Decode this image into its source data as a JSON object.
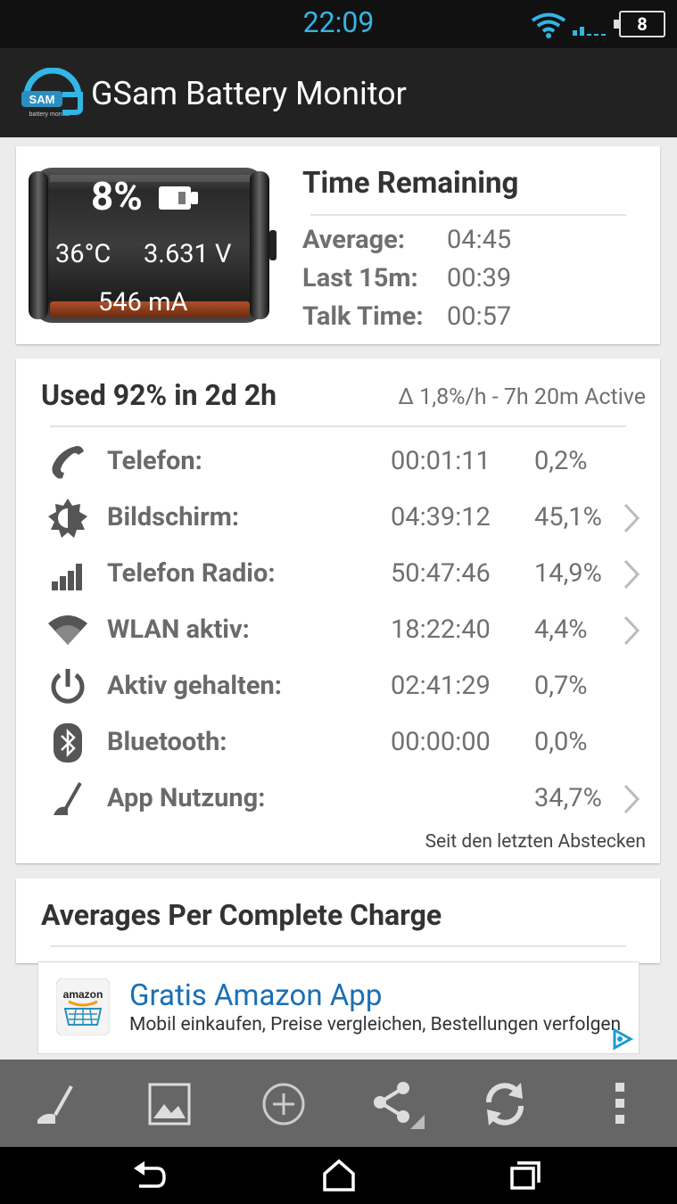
{
  "status_bar": {
    "time": "22:09",
    "battery_level": "8",
    "icons": [
      "wifi-icon",
      "signal-icon",
      "battery-icon"
    ]
  },
  "app": {
    "title": "GSam Battery Monitor",
    "logo_text": "SAM",
    "logo_subtext": "battery monitor"
  },
  "battery": {
    "percent": "8%",
    "temperature": "36°C",
    "voltage": "3.631 V",
    "current": "546 mA"
  },
  "time_remaining": {
    "title": "Time Remaining",
    "rows": [
      {
        "label": "Average:",
        "value": "04:45"
      },
      {
        "label": "Last 15m:",
        "value": "00:39"
      },
      {
        "label": "Talk Time:",
        "value": "00:57"
      }
    ]
  },
  "usage": {
    "title": "Used 92% in 2d 2h",
    "rate": "Δ 1,8%/h - 7h 20m Active",
    "rows": [
      {
        "icon": "phone-icon",
        "label": "Telefon:",
        "time": "00:01:11",
        "percent": "0,2%",
        "has_detail": false
      },
      {
        "icon": "brightness-icon",
        "label": "Bildschirm:",
        "time": "04:39:12",
        "percent": "45,1%",
        "has_detail": true
      },
      {
        "icon": "signal-bars-icon",
        "label": "Telefon Radio:",
        "time": "50:47:46",
        "percent": "14,9%",
        "has_detail": true
      },
      {
        "icon": "wifi-icon",
        "label": "WLAN aktiv:",
        "time": "18:22:40",
        "percent": "4,4%",
        "has_detail": true
      },
      {
        "icon": "power-icon",
        "label": "Aktiv gehalten:",
        "time": "02:41:29",
        "percent": "0,7%",
        "has_detail": false
      },
      {
        "icon": "bluetooth-icon",
        "label": "Bluetooth:",
        "time": "00:00:00",
        "percent": "0,0%",
        "has_detail": false
      },
      {
        "icon": "gauge-icon",
        "label": "App Nutzung:",
        "time": "",
        "percent": "34,7%",
        "has_detail": true
      }
    ],
    "footer": "Seit den letzten Abstecken"
  },
  "averages": {
    "title": "Averages Per Complete Charge"
  },
  "ad": {
    "logo_text": "amazon",
    "title": "Gratis Amazon App",
    "subtitle": "Mobil einkaufen, Preise vergleichen, Bestellungen verfolgen"
  },
  "toolbar": {
    "buttons": [
      "gauge-icon",
      "image-icon",
      "add-circle-icon",
      "share-icon",
      "refresh-icon",
      "overflow-menu-icon"
    ]
  },
  "navbar": {
    "buttons": [
      "back-icon",
      "home-icon",
      "recents-icon"
    ]
  },
  "colors": {
    "accent": "#33b5e5",
    "action_bar": "#222222",
    "toolbar": "#666666",
    "background": "#ececec",
    "ad_blue": "#1a6fb5"
  }
}
